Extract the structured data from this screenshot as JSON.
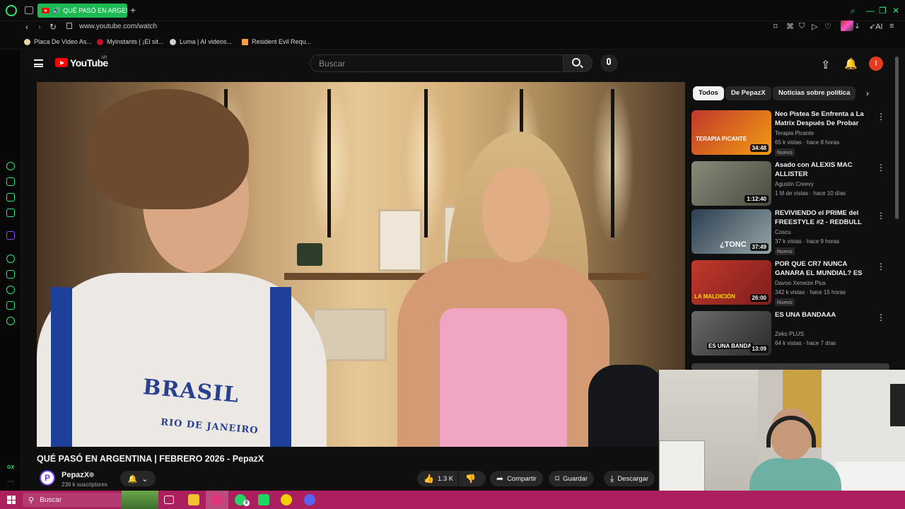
{
  "browser": {
    "tab_title": "QUÉ PASÓ EN ARGENT",
    "url": "www.youtube.com/watch",
    "new_tab_label": "+",
    "ai_label": "AI",
    "bookmarks": [
      {
        "label": "Placa De Video As...",
        "color": "#e8d7a6"
      },
      {
        "label": "Myinstants | ¡El sit...",
        "color": "#c8102e"
      },
      {
        "label": "Luma | AI videos...",
        "color": "#cfcfcf"
      },
      {
        "label": "Resident Evil Requ...",
        "color": "#f0a040"
      }
    ],
    "accent": "#1db954"
  },
  "sidebar": {
    "gx_label": "GX",
    "icons": [
      "history-icon",
      "player-icon",
      "wallet-icon",
      "messenger-icon",
      "twitch-icon",
      "whatsapp-icon",
      "pin-icon",
      "clock-icon",
      "extensions-icon",
      "settings-icon"
    ]
  },
  "youtube": {
    "logo_text": "YouTube",
    "country": "AR",
    "search_placeholder": "Buscar",
    "avatar_letter": "I",
    "video": {
      "title": "QUÉ PASÓ EN ARGENTINA | FEBRERO 2026 - PepazX",
      "channel": "PepazX",
      "subscribers": "239 k suscriptores",
      "likes": "1.3 K",
      "share_label": "Compartir",
      "save_label": "Guardar",
      "download_label": "Descargar",
      "shirt_text": "BRASIL",
      "shirt_subtext": "RIO DE JANEIRO"
    },
    "chips": [
      "Todos",
      "De PepazX",
      "Noticias sobre política"
    ],
    "recommendations": [
      {
        "title": "Neo Pistea Se Enfrenta a La Matrix Después De Probar Las...",
        "channel": "Terapia Picante",
        "verified": true,
        "meta": "65 k vistas · hace 8 horas",
        "badge": "Nuevo",
        "duration": "34:48",
        "thumb_text": "TERAPIA PICANTE",
        "colors": [
          "#c0392b",
          "#f39c12"
        ]
      },
      {
        "title": "Asado con ALEXIS MAC ALLISTER",
        "channel": "Agustín Creevy",
        "verified": false,
        "meta": "1 M de vistas · hace 10 días",
        "badge": "",
        "duration": "1:12:40",
        "thumb_text": "",
        "colors": [
          "#8a8a7a",
          "#4a4a40"
        ]
      },
      {
        "title": "REVIVIENDO el PRIME del FREESTYLE #2 - REDBULL 2015",
        "channel": "Coscu",
        "verified": true,
        "meta": "37 k vistas · hace 9 horas",
        "badge": "Nuevo",
        "duration": "37:49",
        "thumb_text": "¿TONC",
        "colors": [
          "#2c3e50",
          "#95a5a6"
        ]
      },
      {
        "title": "POR QUE CR7 NUNCA GANARA EL MUNDIAL? ES IMPOSIBLE ...",
        "channel": "Davoo Xeneize Plus",
        "verified": true,
        "meta": "342 k vistas · hace 15 horas",
        "badge": "Nuevo",
        "duration": "26:00",
        "thumb_text": "LA MALDICIÓN",
        "colors": [
          "#c0392b",
          "#7f1d1d"
        ]
      },
      {
        "title": "ES UNA BANDAAA",
        "channel": "Zeko PLUS",
        "verified": false,
        "meta": "64 k vistas · hace 7 días",
        "badge": "",
        "duration": "13:09",
        "thumb_text": "ES UNA BANDA",
        "colors": [
          "#6a6a6a",
          "#2a2a2a"
        ]
      }
    ]
  },
  "taskbar": {
    "search_placeholder": "Buscar",
    "whatsapp_badge": "8",
    "color": "#ab1f5f",
    "apps": [
      "task-view-icon",
      "file-explorer-icon",
      "opera-gx-icon",
      "whatsapp-icon",
      "spotify-icon",
      "corsair-icon",
      "discord-icon"
    ]
  }
}
